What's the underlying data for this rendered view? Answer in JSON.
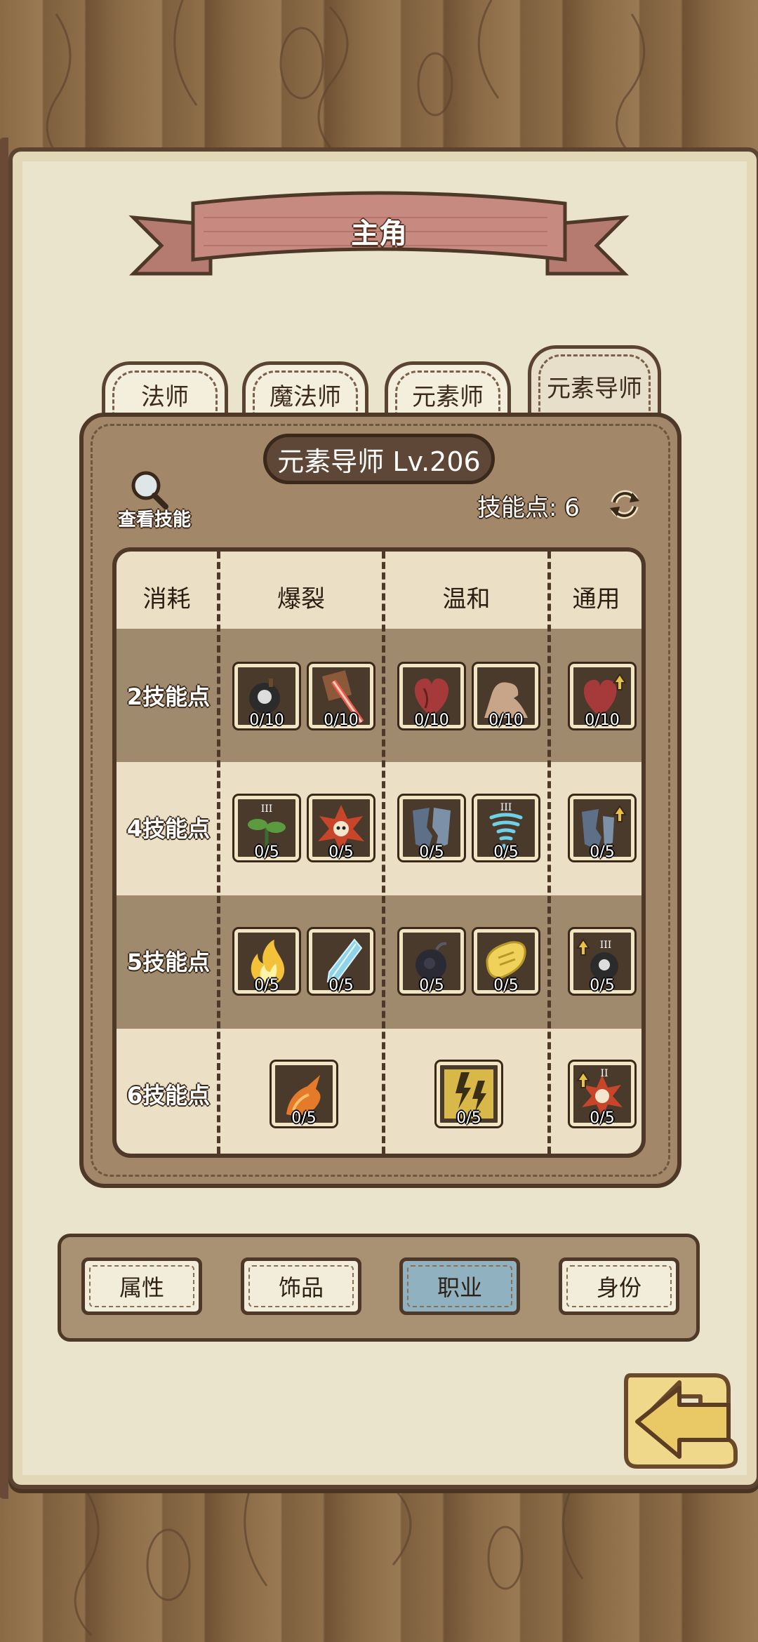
{
  "title": "主角",
  "tabs": [
    {
      "label": "法师",
      "active": false
    },
    {
      "label": "魔法师",
      "active": false
    },
    {
      "label": "元素师",
      "active": false
    },
    {
      "label": "元素导师",
      "active": true
    }
  ],
  "class_level": "元素导师 Lv.206",
  "view_skills_label": "查看技能",
  "skill_points_label": "技能点: 6",
  "table": {
    "headers": [
      "消耗",
      "爆裂",
      "温和",
      "通用"
    ],
    "rows": [
      {
        "cost": "2技能点",
        "skills": [
          {
            "icon": "skull-bomb-icon",
            "count": "0/10"
          },
          {
            "icon": "fire-staff-icon",
            "count": "0/10"
          },
          {
            "icon": "heart-icon",
            "count": "0/10"
          },
          {
            "icon": "muscle-arm-icon",
            "count": "0/10"
          },
          {
            "icon": "heart-upgrade-icon",
            "count": "0/10"
          }
        ]
      },
      {
        "cost": "4技能点",
        "skills": [
          {
            "icon": "sprout-icon",
            "count": "0/5"
          },
          {
            "icon": "skull-explosion-icon",
            "count": "0/5"
          },
          {
            "icon": "broken-shield-icon",
            "count": "0/5"
          },
          {
            "icon": "tornado-icon",
            "count": "0/5"
          },
          {
            "icon": "shield-upgrade-icon",
            "count": "0/5"
          }
        ]
      },
      {
        "cost": "5技能点",
        "skills": [
          {
            "icon": "flame-icon",
            "count": "0/5"
          },
          {
            "icon": "ice-crystal-icon",
            "count": "0/5"
          },
          {
            "icon": "dark-bomb-icon",
            "count": "0/5"
          },
          {
            "icon": "gold-scroll-icon",
            "count": "0/5"
          },
          {
            "icon": "bomb-upgrade-icon",
            "count": "0/5"
          }
        ]
      },
      {
        "cost": "6技能点",
        "skills": [
          {
            "icon": "fire-phoenix-icon",
            "count": "0/5"
          },
          {
            "icon": "lightning-icon",
            "count": "0/5"
          },
          {
            "icon": "skull-explosion-upgrade-icon",
            "count": "0/5"
          }
        ]
      }
    ]
  },
  "nav": [
    {
      "label": "属性",
      "active": false
    },
    {
      "label": "饰品",
      "active": false
    },
    {
      "label": "职业",
      "active": true
    },
    {
      "label": "身份",
      "active": false
    }
  ],
  "colors": {
    "scroll": "#ebe4cc",
    "panel": "#a28869",
    "nav_active": "#8fb1c0",
    "ribbon": "#b57a70"
  }
}
